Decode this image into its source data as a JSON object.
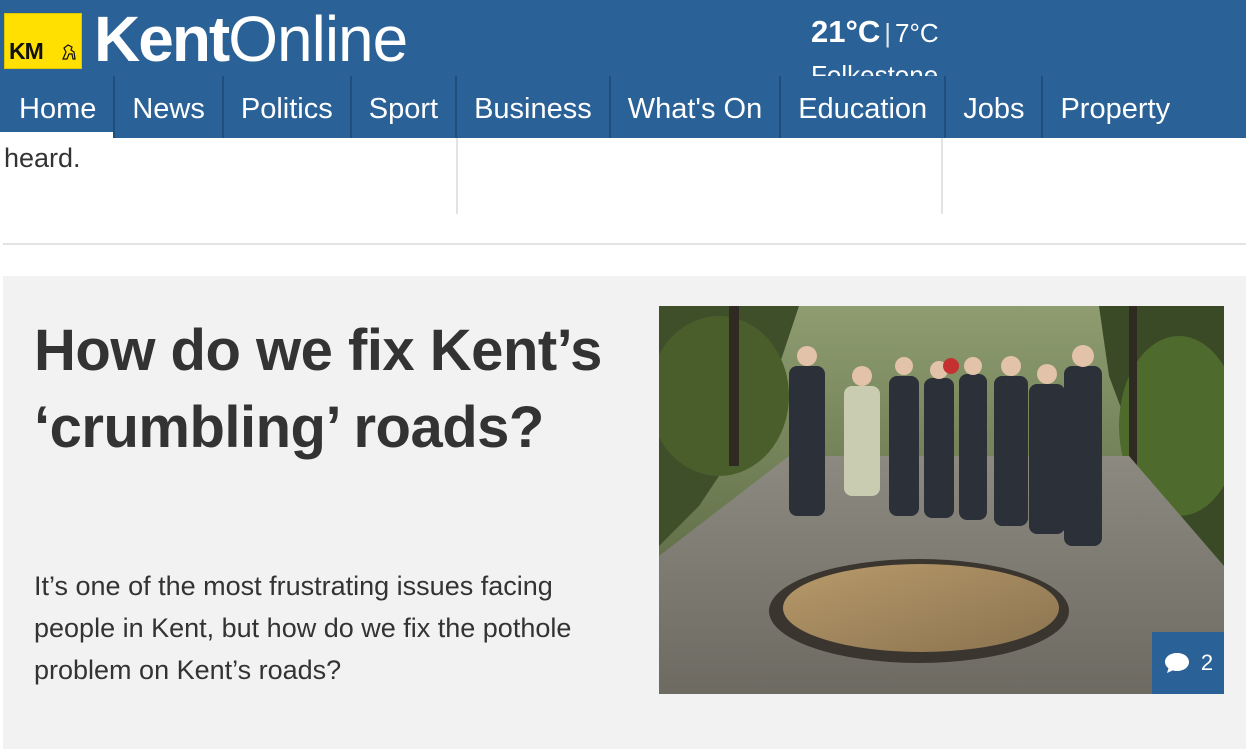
{
  "header": {
    "logo_text": "KM",
    "brand_bold": "Kent",
    "brand_light": "Online",
    "weather": {
      "high": "21°C",
      "separator": "|",
      "low": "7°C",
      "location": "Folkestone"
    },
    "colors": {
      "header_bg": "#2a6196",
      "logo_yellow": "#ffe000"
    }
  },
  "nav": {
    "items": [
      {
        "label": "Home",
        "active": true
      },
      {
        "label": "News"
      },
      {
        "label": "Politics"
      },
      {
        "label": "Sport"
      },
      {
        "label": "Business"
      },
      {
        "label": "What's On"
      },
      {
        "label": "Education"
      },
      {
        "label": "Jobs"
      },
      {
        "label": "Property"
      }
    ]
  },
  "previous_story": {
    "text_tail": "heard."
  },
  "feature": {
    "headline": "How do we fix Kent’s ‘crumbling’ roads?",
    "standfirst": "It’s one of the most frustrating issues facing people in Kent, but how do we fix the pothole problem on Kent’s roads?",
    "image_icon": "photo-of-residents-by-pothole",
    "comments": {
      "icon": "speech-bubble-icon",
      "count": "2"
    }
  }
}
